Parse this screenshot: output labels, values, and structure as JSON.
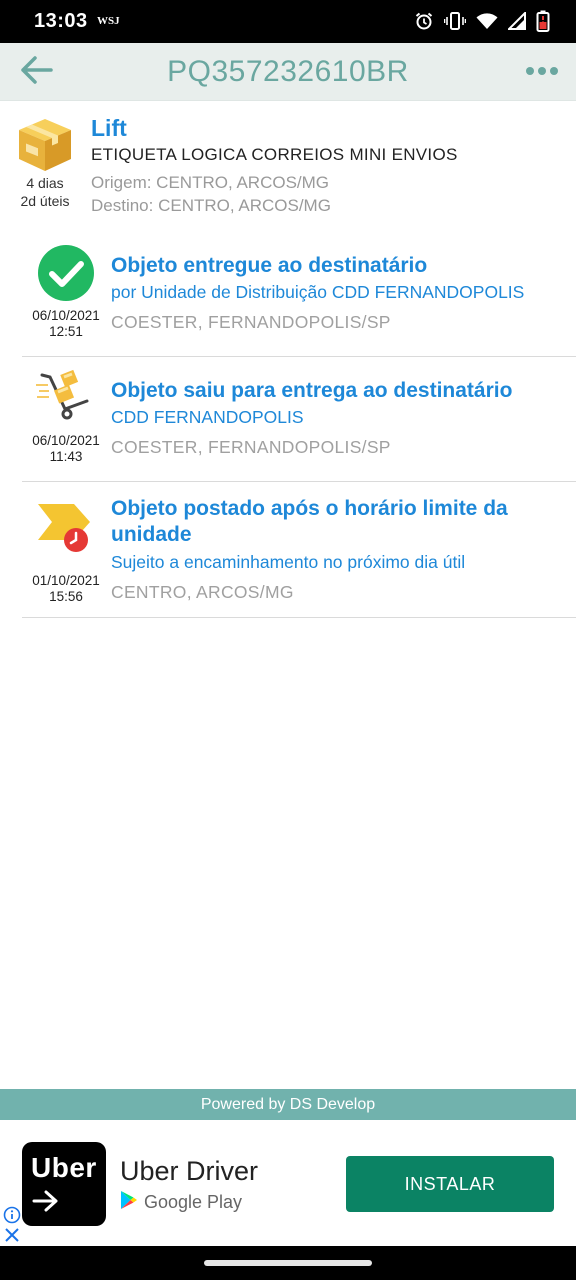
{
  "status_bar": {
    "time": "13:03",
    "notification": "WSJ",
    "icons": [
      "alarm-icon",
      "vibrate-icon",
      "wifi-icon",
      "signal-icon",
      "battery-icon"
    ]
  },
  "app_bar": {
    "title": "PQ357232610BR",
    "back_icon": "arrow-left-icon",
    "menu_icon": "more-horizontal-icon"
  },
  "package": {
    "name": "Lift",
    "description": "ETIQUETA LOGICA CORREIOS MINI ENVIOS",
    "origin": "Origem: CENTRO, ARCOS/MG",
    "destination": "Destino: CENTRO, ARCOS/MG",
    "days": "4 dias",
    "business_days": "2d úteis",
    "icon": "package-box-icon"
  },
  "events": [
    {
      "title": "Objeto entregue ao destinatário",
      "subtitle": "por Unidade de Distribuição CDD FERNANDOPOLIS",
      "location": "COESTER, FERNANDOPOLIS/SP",
      "date": "06/10/2021",
      "time": "12:51",
      "icon": "delivered-check-icon"
    },
    {
      "title": "Objeto saiu para entrega ao destinatário",
      "subtitle": "CDD FERNANDOPOLIS",
      "location": "COESTER, FERNANDOPOLIS/SP",
      "date": "06/10/2021",
      "time": "11:43",
      "icon": "hand-truck-icon"
    },
    {
      "title": "Objeto postado após o horário limite da unidade",
      "subtitle": "Sujeito a encaminhamento no próximo dia útil",
      "location": "CENTRO, ARCOS/MG",
      "date": "01/10/2021",
      "time": "15:56",
      "icon": "posted-late-clock-icon"
    }
  ],
  "footer": {
    "powered_by": "Powered by DS Develop"
  },
  "ad": {
    "logo_text": "Uber",
    "app_name": "Uber Driver",
    "store": "Google Play",
    "install_label": "INSTALAR"
  },
  "colors": {
    "accent_blue": "#1e88d8",
    "title_teal": "#6aa7a0",
    "footer_teal": "#71b2ad",
    "install_green": "#0b8364",
    "check_green": "#21b862",
    "gray_text": "#9a9a9a"
  }
}
